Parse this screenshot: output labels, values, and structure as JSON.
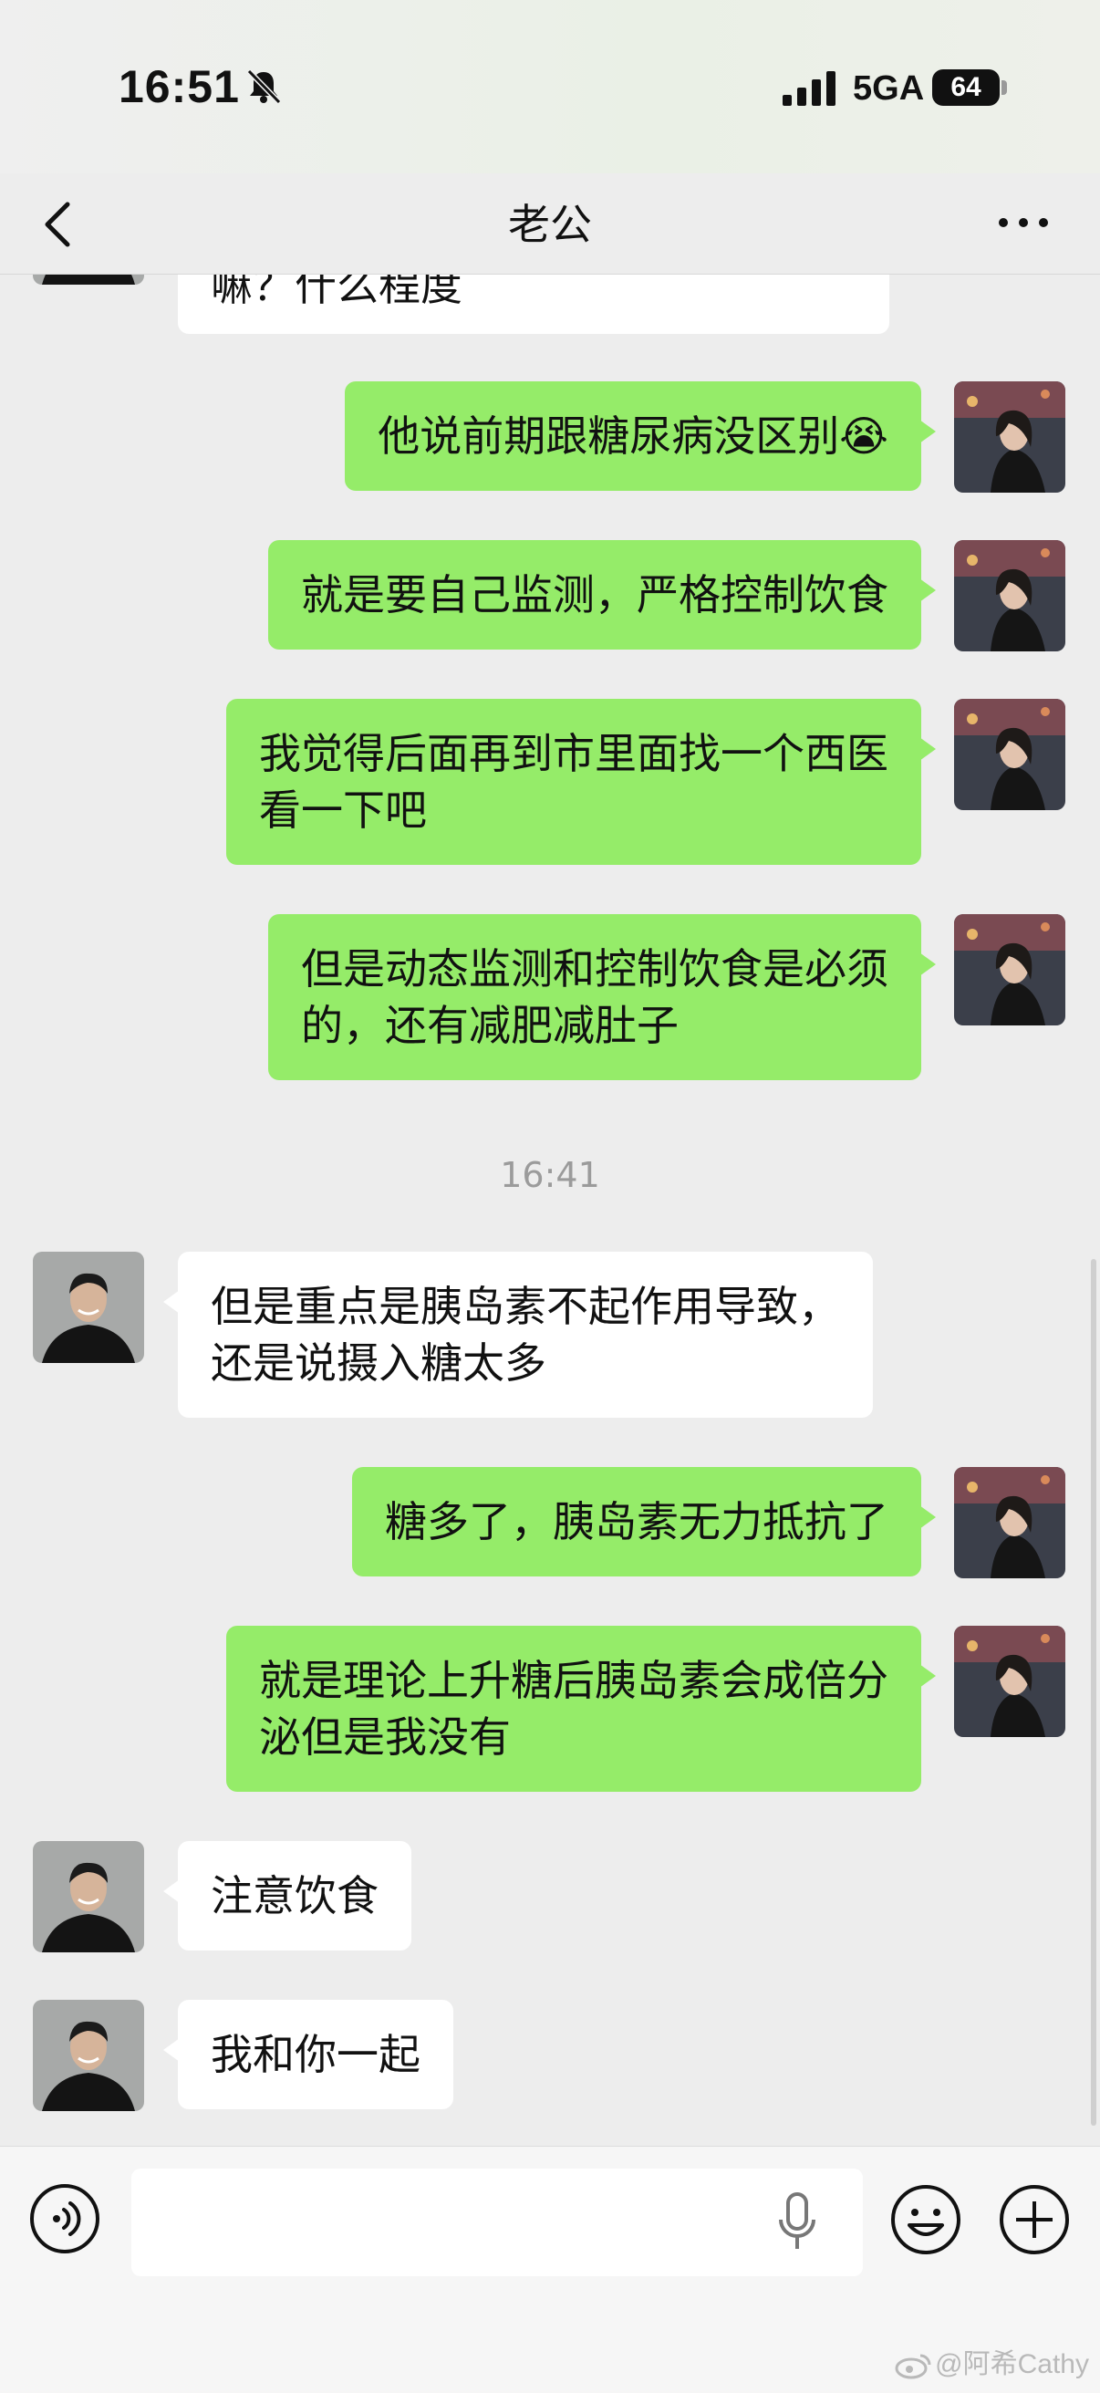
{
  "status_bar": {
    "time": "16:51",
    "network": "5GA",
    "battery": "64"
  },
  "header": {
    "title": "老公"
  },
  "messages": [
    {
      "from": "him",
      "text": "嘛？什么程度"
    },
    {
      "from": "me",
      "text": "他说前期跟糖尿病没区别😭"
    },
    {
      "from": "me",
      "text": "就是要自己监测，严格控制饮食"
    },
    {
      "from": "me",
      "text": "我觉得后面再到市里面找一个西医\n看一下吧"
    },
    {
      "from": "me",
      "text": "但是动态监测和控制饮食是必须\n的，还有减肥减肚子"
    },
    {
      "type": "time",
      "text": "16:41"
    },
    {
      "from": "him",
      "text": "但是重点是胰岛素不起作用导致，\n还是说摄入糖太多"
    },
    {
      "from": "me",
      "text": "糖多了，胰岛素无力抵抗了"
    },
    {
      "from": "me",
      "text": "就是理论上升糖后胰岛素会成倍分\n泌但是我没有"
    },
    {
      "from": "him",
      "text": "注意饮食"
    },
    {
      "from": "him",
      "text": "我和你一起"
    }
  ],
  "watermark": "@阿希Cathy",
  "icons": [
    "bell-off-icon",
    "signal-icon",
    "battery-icon",
    "back-icon",
    "more-icon",
    "voice-icon",
    "mic-icon",
    "emoji-icon",
    "plus-icon"
  ]
}
